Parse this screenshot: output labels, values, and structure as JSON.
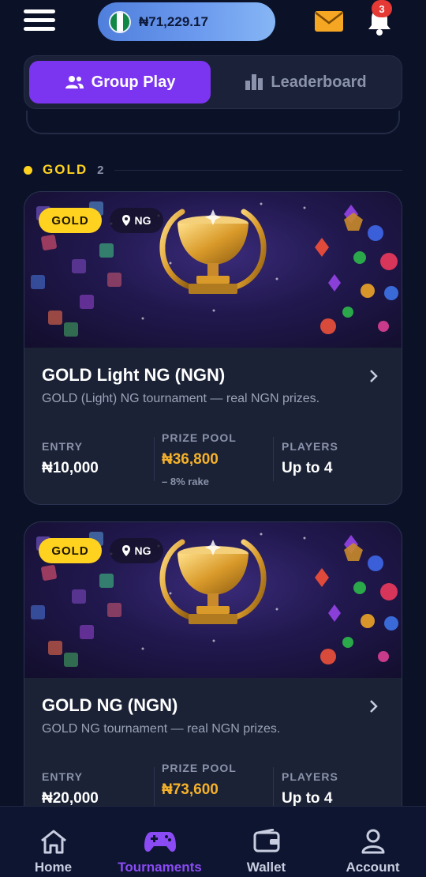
{
  "header": {
    "balance": "₦71,229.17",
    "notification_count": "3"
  },
  "tabs": [
    {
      "label": "Group Play",
      "active": true
    },
    {
      "label": "Leaderboard",
      "active": false
    }
  ],
  "section": {
    "title": "GOLD",
    "count": "2"
  },
  "cards": [
    {
      "tier": "GOLD",
      "location": "NG",
      "title": "GOLD Light NG (NGN)",
      "subtitle": "GOLD (Light) NG tournament — real NGN prizes.",
      "entry_label": "ENTRY",
      "entry_value": "₦10,000",
      "prize_label": "PRIZE POOL",
      "prize_value": "₦36,800",
      "prize_note": "– 8% rake",
      "players_label": "PLAYERS",
      "players_value": "Up to 4"
    },
    {
      "tier": "GOLD",
      "location": "NG",
      "title": "GOLD NG (NGN)",
      "subtitle": "GOLD NG tournament — real NGN prizes.",
      "entry_label": "ENTRY",
      "entry_value": "₦20,000",
      "prize_label": "PRIZE POOL",
      "prize_value": "₦73,600",
      "players_label": "PLAYERS",
      "players_value": "Up to 4"
    }
  ],
  "nav": [
    {
      "label": "Home",
      "icon": "home-icon"
    },
    {
      "label": "Tournaments",
      "icon": "gamepad-icon",
      "active": true
    },
    {
      "label": "Wallet",
      "icon": "wallet-icon"
    },
    {
      "label": "Account",
      "icon": "user-icon"
    }
  ],
  "colors": {
    "accent": "#7b35f0",
    "gold": "#ffd21f",
    "prize": "#f5b12b",
    "background": "#0b1228"
  }
}
